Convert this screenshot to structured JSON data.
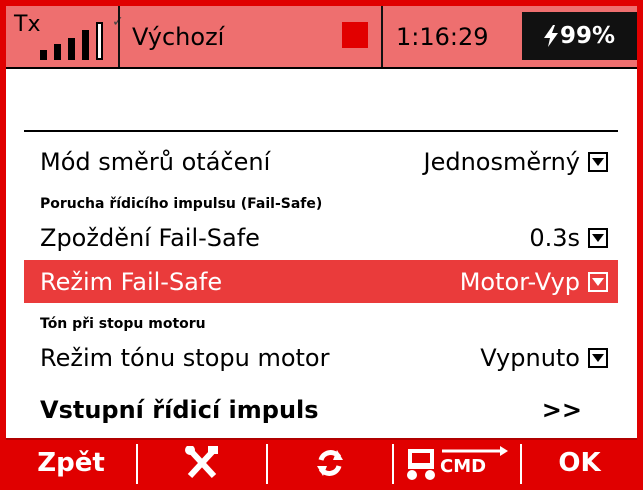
{
  "status": {
    "tx_label": "Tx",
    "profile": "Výchozí",
    "time": "1:16:29",
    "battery": "99%",
    "battery_icon": "lightning-icon"
  },
  "rows": [
    {
      "label": "Mód směrů otáčení",
      "value": "Jednosměrný"
    },
    {
      "label": "Zpoždění Fail-Safe",
      "value": "0.3s"
    },
    {
      "label": "Režim Fail-Safe",
      "value": "Motor-Vyp"
    },
    {
      "label": "Režim tónu stopu motor",
      "value": "Vypnuto"
    }
  ],
  "sections": {
    "failsafe": "Porucha řídicího impulsu (Fail-Safe)",
    "tone": "Tón při stopu motoru"
  },
  "link_row": {
    "label": "Vstupní řídicí impuls",
    "value": ">>"
  },
  "toolbar": {
    "back": "Zpět",
    "tools_icon": "tools-icon",
    "refresh_icon": "refresh-icon",
    "cmd_icon": "cmd-icon",
    "cmd_text": "CMD",
    "ok": "OK"
  },
  "colors": {
    "accent": "#e00000",
    "status_bg": "#ee6f6f",
    "selected_row": "#ea3b3b"
  }
}
